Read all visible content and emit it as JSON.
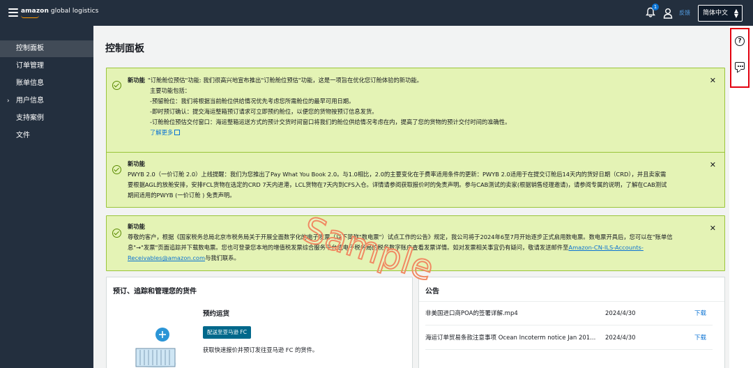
{
  "topbar": {
    "logo_brand": "amazon",
    "logo_rest": "global logistics",
    "notification_count": "1",
    "feedback": "反馈",
    "language": "简体中文"
  },
  "sidebar": {
    "items": [
      {
        "label": "控制面板"
      },
      {
        "label": "订单管理"
      },
      {
        "label": "账单信息"
      },
      {
        "label": "用户信息"
      },
      {
        "label": "支持案例"
      },
      {
        "label": "文件"
      }
    ]
  },
  "page": {
    "title": "控制面板"
  },
  "alerts": [
    {
      "label": "新功能",
      "lines": [
        "\"订舱舱位预估\"功能: 我们很高兴地宣布推出\"订舱舱位预估\"功能，这是一项旨在优化您订舱体验的新功能。",
        "主要功能包括：",
        "-预留舱位：我们将根据当前舱位供给情况优先考虑您所需舱位的最早可用日期。",
        "-即时预订确认：提交海运整箱预订请求可立即预约舱位，以便您的货物按预订信息发货。",
        "-订舱舱位预估交付窗口：海运整箱运送方式的预计交货时间窗口将我们的舱位供给情况考虑在内，提高了您的货物的预计交付时间的准确性。"
      ],
      "link": "了解更多"
    },
    {
      "label": "新功能",
      "lines": [
        "PWYB 2.0（一价订舱 2.0）上线提醒：我们为您推出了Pay What You Book 2.0。与1.0相比，2.0的主要变化在于费率适用条件的更新：PWYB 2.0适用于在提交订舱后14天内的货好日期（CRD），并且卖家需",
        "要根据AGL的放舱安排，安排FCL货物在选定的CRD 7天内进港，LCL货物在7天内到CFS入仓。详情请参阅获取报价时的免责声明。参与CAB测试的卖家(根据销售经理邀请)，请参阅专属的说明，了解在CAB测试",
        "期间适用的PWYB (一价订舱 ) 免责声明。"
      ]
    },
    {
      "label": "新功能",
      "lines": [
        "尊敬的客户，根据《国家税务总局北京市税务局关于开展全面数字化的电子发票（以下简称\"数电票\"）试点工作的公告》规定，我公司将于2024年6至7月开始逐步正式启用数电票。数电票开具后，您可以在\"账单信",
        "息\"→\"发票\"页面追踪并下载数电票。您也可登录您本地的增值税发票综合服务平台或电子税务局的税务数字账户查看发票详情。如对发票相关事宜仍有疑问，敬请发送邮件至"
      ],
      "email": "Amazon-CN-ILS-Accounts-Receivables@amazon.com",
      "email_line1": "Amazon-CN-ILS-Accounts-",
      "email_line2": "Receivables@amazon.com",
      "tail": "与我们联系。"
    }
  ],
  "shipments": {
    "title": "预订、追踪和管理您的货件",
    "subtitle": "预约运货",
    "button": "配送至亚马逊 FC",
    "desc": "获取快速报价并预订发往亚马逊 FC 的货件。"
  },
  "announcements": {
    "title": "公告",
    "rows": [
      {
        "title": "非美国进口商POA的签署详解.mp4",
        "date": "2024/4/30",
        "action": "下载"
      },
      {
        "title": "海运订单贸易条款注意事项 Ocean Incoterm notice Jan 201...",
        "date": "2024/4/30",
        "action": "下载"
      }
    ]
  },
  "watermark": "Sample",
  "colors": {
    "topbar": "#232f3e",
    "sidebar_active": "#414b57",
    "alert_bg": "#e4f3b5",
    "alert_border": "#9ac53a",
    "link": "#0972d3",
    "button": "#00688b",
    "highlight": "#e3000f"
  },
  "icons": [
    "menu-icon",
    "bell-icon",
    "user-icon",
    "chevron-updown-icon",
    "check-circle-icon",
    "close-icon",
    "external-link-icon",
    "help-icon",
    "chat-icon",
    "caret-right-icon"
  ]
}
